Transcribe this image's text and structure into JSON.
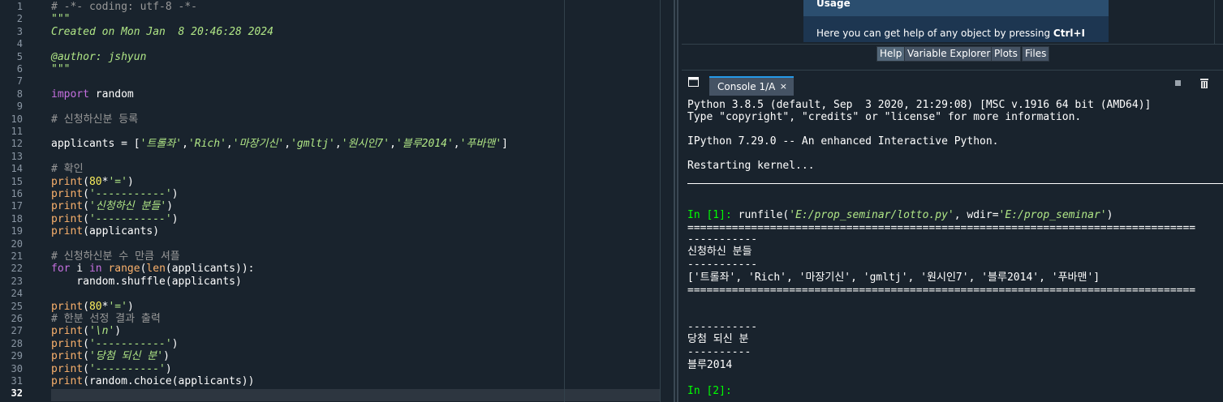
{
  "editor": {
    "line_numbers": [
      "1",
      "2",
      "3",
      "4",
      "5",
      "6",
      "7",
      "8",
      "9",
      "10",
      "11",
      "12",
      "13",
      "14",
      "15",
      "16",
      "17",
      "18",
      "19",
      "20",
      "21",
      "22",
      "23",
      "24",
      "25",
      "26",
      "27",
      "28",
      "29",
      "30",
      "31",
      "32"
    ],
    "lines": [
      [
        [
          "c-com",
          "# -*- coding: utf-8 -*-"
        ]
      ],
      [
        [
          "c-str",
          "\"\"\""
        ]
      ],
      [
        [
          "c-str",
          "Created on Mon Jan  8 20:46:28 2024"
        ]
      ],
      [
        [
          "",
          ""
        ]
      ],
      [
        [
          "c-str",
          "@author: jshyun"
        ]
      ],
      [
        [
          "c-str",
          "\"\"\""
        ]
      ],
      [
        [
          "",
          ""
        ]
      ],
      [
        [
          "c-kw",
          "import"
        ],
        [
          "",
          " random"
        ]
      ],
      [
        [
          "",
          ""
        ]
      ],
      [
        [
          "c-com",
          "# 신청하신분 등록"
        ]
      ],
      [
        [
          "",
          ""
        ]
      ],
      [
        [
          "",
          "applicants = ["
        ],
        [
          "c-str",
          "'트롤좌'"
        ],
        [
          "",
          ","
        ],
        [
          "c-str",
          "'Rich'"
        ],
        [
          "",
          ","
        ],
        [
          "c-str",
          "'마장기신'"
        ],
        [
          "",
          ","
        ],
        [
          "c-str",
          "'gmltj'"
        ],
        [
          "",
          ","
        ],
        [
          "c-str",
          "'원시인7'"
        ],
        [
          "",
          ","
        ],
        [
          "c-str",
          "'블루2014'"
        ],
        [
          "",
          ","
        ],
        [
          "c-str",
          "'푸바맨'"
        ],
        [
          "",
          "]"
        ]
      ],
      [
        [
          "",
          ""
        ]
      ],
      [
        [
          "c-com",
          "# 확인"
        ]
      ],
      [
        [
          "c-bi",
          "print"
        ],
        [
          "",
          "("
        ],
        [
          "c-num",
          "80"
        ],
        [
          "",
          "*"
        ],
        [
          "c-str",
          "'='"
        ],
        [
          "",
          ")"
        ]
      ],
      [
        [
          "c-bi",
          "print"
        ],
        [
          "",
          "("
        ],
        [
          "c-str",
          "'-----------'"
        ],
        [
          "",
          ")"
        ]
      ],
      [
        [
          "c-bi",
          "print"
        ],
        [
          "",
          "("
        ],
        [
          "c-str",
          "'신청하신 분들'"
        ],
        [
          "",
          ")"
        ]
      ],
      [
        [
          "c-bi",
          "print"
        ],
        [
          "",
          "("
        ],
        [
          "c-str",
          "'-----------'"
        ],
        [
          "",
          ")"
        ]
      ],
      [
        [
          "c-bi",
          "print"
        ],
        [
          "",
          "(applicants)"
        ]
      ],
      [
        [
          "",
          ""
        ]
      ],
      [
        [
          "c-com",
          "# 신청하신분 수 만큼 셔플"
        ]
      ],
      [
        [
          "c-kw",
          "for"
        ],
        [
          "",
          " i "
        ],
        [
          "c-kw",
          "in"
        ],
        [
          "",
          " "
        ],
        [
          "c-bi",
          "range"
        ],
        [
          "",
          "("
        ],
        [
          "c-bi",
          "len"
        ],
        [
          "",
          "(applicants)):"
        ]
      ],
      [
        [
          "",
          "    random.shuffle(applicants)"
        ]
      ],
      [
        [
          "",
          ""
        ]
      ],
      [
        [
          "c-bi",
          "print"
        ],
        [
          "",
          "("
        ],
        [
          "c-num",
          "80"
        ],
        [
          "",
          "*"
        ],
        [
          "c-str",
          "'='"
        ],
        [
          "",
          ")"
        ]
      ],
      [
        [
          "c-com",
          "# 한분 선정 결과 출력"
        ]
      ],
      [
        [
          "c-bi",
          "print"
        ],
        [
          "",
          "("
        ],
        [
          "c-str",
          "'\\n'"
        ],
        [
          "",
          ")"
        ]
      ],
      [
        [
          "c-bi",
          "print"
        ],
        [
          "",
          "("
        ],
        [
          "c-str",
          "'-----------'"
        ],
        [
          "",
          ")"
        ]
      ],
      [
        [
          "c-bi",
          "print"
        ],
        [
          "",
          "("
        ],
        [
          "c-str",
          "'당첨 되신 분'"
        ],
        [
          "",
          ")"
        ]
      ],
      [
        [
          "c-bi",
          "print"
        ],
        [
          "",
          "("
        ],
        [
          "c-str",
          "'----------'"
        ],
        [
          "",
          ")"
        ]
      ],
      [
        [
          "c-bi",
          "print"
        ],
        [
          "",
          "(random.choice(applicants))"
        ]
      ],
      [
        [
          "",
          ""
        ]
      ]
    ]
  },
  "help": {
    "title": "Usage",
    "body_prefix": "Here you can get help of any object by pressing ",
    "body_shortcut": "Ctrl+I",
    "tabs": [
      "Help",
      "Variable Explorer",
      "Plots",
      "Files"
    ]
  },
  "console": {
    "tab_label": "Console 1/A",
    "close_glyph": "×",
    "lines": {
      "l1": "Python 3.8.5 (default, Sep  3 2020, 21:29:08) [MSC v.1916 64 bit (AMD64)]",
      "l2": "Type \"copyright\", \"credits\" or \"license\" for more information.",
      "l3": "IPython 7.29.0 -- An enhanced Interactive Python.",
      "l4": "Restarting kernel...",
      "in1_prompt": "In [1]: ",
      "in1_fn": "runfile(",
      "in1_arg1": "'E:/prop_seminar/lotto.py'",
      "in1_mid": ", wdir=",
      "in1_arg2": "'E:/prop_seminar'",
      "in1_end": ")",
      "eq1": "================================================================================",
      "dash1": "-----------",
      "out1": "신청하신 분들",
      "dash2": "-----------",
      "list": "['트롤좌', 'Rich', '마장기신', 'gmltj', '원시인7', '블루2014', '푸바맨']",
      "eq2": "================================================================================",
      "dash3": "-----------",
      "out2": "당첨 되신 분",
      "dash4": "----------",
      "winner": "블루2014",
      "in2_prompt": "In [2]:"
    }
  }
}
